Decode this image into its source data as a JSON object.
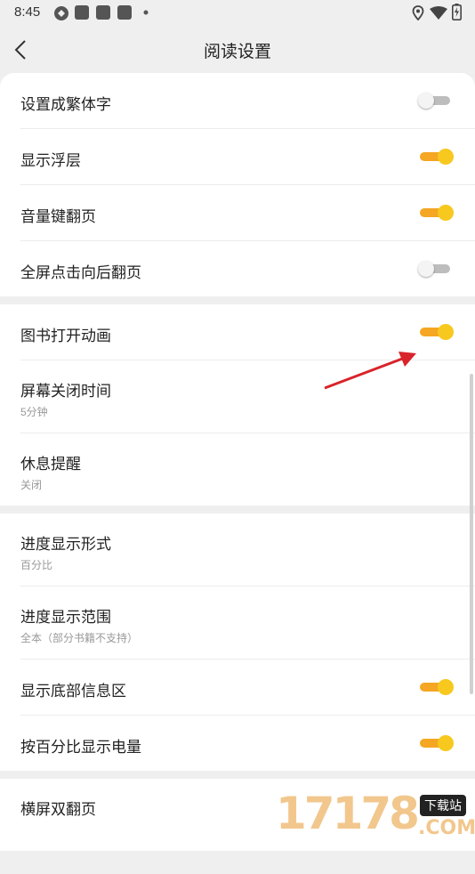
{
  "status": {
    "time": "8:45",
    "icons": [
      "app-icon",
      "notification-icon",
      "notification-icon",
      "notification-icon",
      "dot-icon",
      "location-icon",
      "wifi-icon",
      "battery-icon"
    ]
  },
  "appbar": {
    "title": "阅读设置",
    "back_icon": "back-arrow-icon"
  },
  "groups": [
    {
      "items": [
        {
          "label": "设置成繁体字",
          "toggle": false
        },
        {
          "label": "显示浮层",
          "toggle": true
        },
        {
          "label": "音量键翻页",
          "toggle": true
        },
        {
          "label": "全屏点击向后翻页",
          "toggle": false
        }
      ]
    },
    {
      "items": [
        {
          "label": "图书打开动画",
          "toggle": true
        },
        {
          "label": "屏幕关闭时间",
          "sub": "5分钟"
        },
        {
          "label": "休息提醒",
          "sub": "关闭"
        }
      ]
    },
    {
      "items": [
        {
          "label": "进度显示形式",
          "sub": "百分比"
        },
        {
          "label": "进度显示范围",
          "sub": "全本（部分书籍不支持）"
        },
        {
          "label": "显示底部信息区",
          "toggle": true
        },
        {
          "label": "按百分比显示电量",
          "toggle": true
        }
      ]
    },
    {
      "items": [
        {
          "label": "横屏双翻页"
        }
      ]
    }
  ],
  "watermark": {
    "number": "17178",
    "tag": "下载站",
    "domain": ".COM"
  },
  "colors": {
    "accent": "#f5a623",
    "knob_on": "#f7c81e",
    "arrow": "#d9232a"
  }
}
